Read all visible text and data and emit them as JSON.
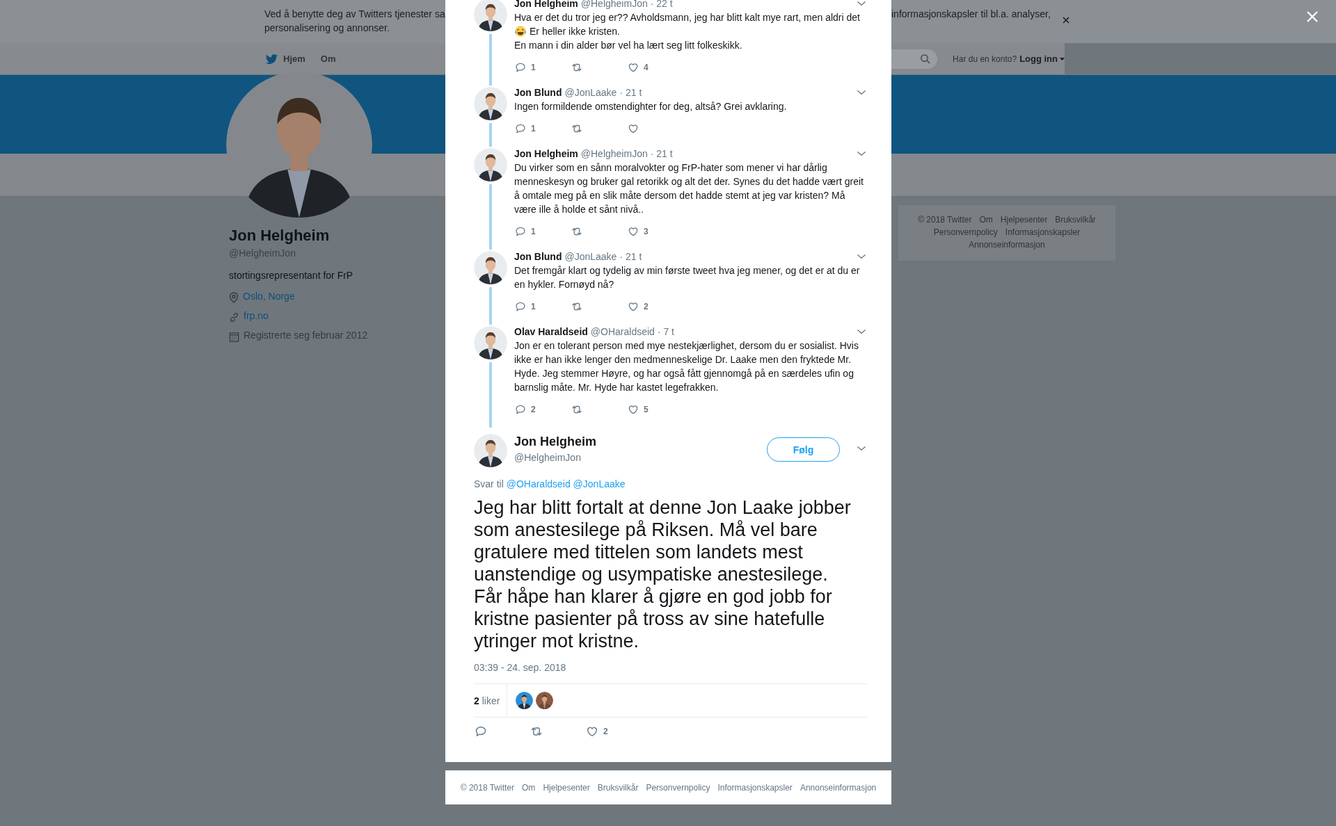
{
  "cookie_banner": {
    "text_parts": [
      "Ved å benytte deg av Twitters tjenester sa",
      "informasjonskapsler til bl.a. analyser,",
      "personalisering og annonser."
    ]
  },
  "nav": {
    "items": [
      {
        "label": "Hjem",
        "kind": "home"
      },
      {
        "label": "Om",
        "kind": "plain"
      }
    ],
    "login_prompt": "Har du en konto?",
    "login_link": "Logg inn"
  },
  "profile": {
    "photo": {
      "kind": "picture"
    },
    "name": "Jon Helgheim",
    "handle": "@HelgheimJon",
    "bio": "stortingsrepresentant for FrP",
    "details": [
      {
        "kind": "location",
        "text": "Oslo, Norge",
        "link": true
      },
      {
        "kind": "url",
        "text": "frp.no",
        "link": true
      },
      {
        "kind": "joined",
        "text": "Registrerte seg februar 2012",
        "link": false
      }
    ]
  },
  "sidebar_footer": {
    "links": [
      "© 2018 Twitter",
      "Om",
      "Hjelpesenter",
      "Bruksvilkår",
      "Personvernpolicy",
      "Informasjonskapsler",
      "Annonseinformasjon"
    ]
  },
  "thread": [
    {
      "name": "Jon Helgheim",
      "handle": "@HelgheimJon",
      "time": "· 22 t",
      "paragraphs": [
        {
          "text": "Hva er det du tror jeg er?? Avholdsmann, jeg har blitt kalt mye rart, men aldri det",
          "emoji": false
        },
        {
          "text": "Er heller ikke kristen.",
          "emoji": true
        },
        {
          "text": "En mann i din alder bør vel ha lært seg litt folkeskikk.",
          "emoji": false
        }
      ],
      "replies": "1",
      "likes": "4"
    },
    {
      "name": "Jon Blund",
      "handle": "@JonLaake",
      "time": "· 21 t",
      "paragraphs": [
        {
          "text": "Ingen formildende omstendighter for deg, altså? Grei avklaring.",
          "emoji": false
        }
      ],
      "replies": "1"
    },
    {
      "name": "Jon Helgheim",
      "handle": "@HelgheimJon",
      "time": "· 21 t",
      "paragraphs": [
        {
          "text": "Du virker som en sånn moralvokter og FrP-hater som mener vi har dårlig menneskesyn og bruker gal retorikk og alt det der. Synes du det hadde vært greit å omtale meg på en slik måte dersom det hadde stemt at jeg var kristen? Må være ille å holde et sånt nivå..",
          "emoji": false
        }
      ],
      "replies": "1",
      "likes": "3"
    },
    {
      "name": "Jon Blund",
      "handle": "@JonLaake",
      "time": "· 21 t",
      "paragraphs": [
        {
          "text": "Det fremgår klart og tydelig av min første tweet hva jeg mener, og det er at du er en hykler. Fornøyd nå?",
          "emoji": false
        }
      ],
      "replies": "1",
      "likes": "2"
    },
    {
      "name": "Olav Haraldseid",
      "handle": "@OHaraldseid",
      "time": "· 7 t",
      "paragraphs": [
        {
          "text": "Jon er en tolerant person med mye nestekjærlighet, dersom du er sosialist. Hvis ikke er han ikke lenger den medmenneskelige Dr. Laake men den fryktede Mr. Hyde. Jeg stemmer Høyre, og har også fått gjennomgå på en særdeles ufin og barnslig måte. Mr. Hyde har kastet legefrakken.",
          "emoji": false
        }
      ],
      "replies": "2",
      "likes": "5"
    }
  ],
  "focused_tweet": {
    "name": "Jon Helgheim",
    "handle": "@HelgheimJon",
    "follow_button": "Følg",
    "reply_to_label": "Svar til",
    "reply_to": [
      "@OHaraldseid",
      "@JonLaake"
    ],
    "text": "Jeg har blitt fortalt at denne Jon Laake jobber som anestesilege på Riksen. Må vel bare gratulere med tittelen som landets mest uanstendige og usympatiske anestesilege. Får håpe han klarer å gjøre en god jobb for kristne pasienter på tross av sine hatefulle ytringer mot kristne.",
    "timestamp": "03:39 - 24. sep. 2018",
    "likes_summary": "**2** liker",
    "likers": [
      {
        "kind": "picture"
      },
      {
        "kind": "picture"
      }
    ],
    "likes": "2"
  },
  "modal_footer": {
    "links": [
      "© 2018 Twitter",
      "Om",
      "Hjelpesenter",
      "Bruksvilkår",
      "Personvernpolicy",
      "Informasjonskapsler",
      "Annonseinformasjon"
    ]
  }
}
